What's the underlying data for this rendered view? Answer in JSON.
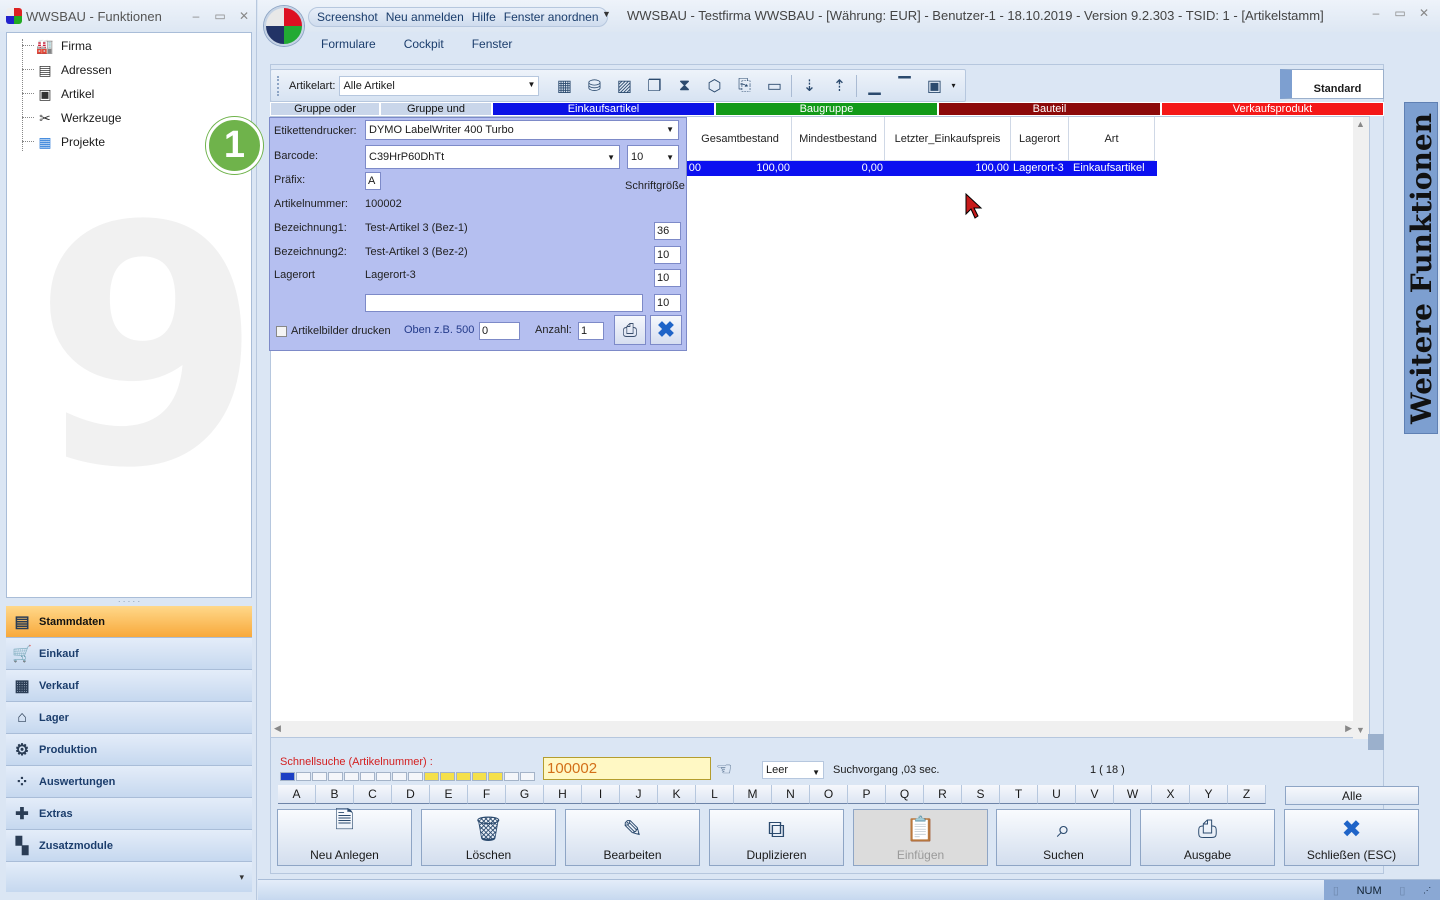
{
  "left_window": {
    "title": "WWSBAU - Funktionen",
    "controls": {
      "minimize": "–",
      "maximize": "▭",
      "close": "✕"
    },
    "watermark": "9",
    "tree": [
      {
        "label": "Firma",
        "icon": "factory-icon"
      },
      {
        "label": "Adressen",
        "icon": "address-card-icon"
      },
      {
        "label": "Artikel",
        "icon": "box-icon"
      },
      {
        "label": "Werkzeuge",
        "icon": "tools-icon"
      },
      {
        "label": "Projekte",
        "icon": "project-icon"
      }
    ],
    "nav": [
      {
        "label": "Stammdaten",
        "icon": "master-data-icon",
        "active": true
      },
      {
        "label": "Einkauf",
        "icon": "cart-icon"
      },
      {
        "label": "Verkauf",
        "icon": "cash-register-icon"
      },
      {
        "label": "Lager",
        "icon": "warehouse-icon"
      },
      {
        "label": "Produktion",
        "icon": "production-icon"
      },
      {
        "label": "Auswertungen",
        "icon": "analytics-icon"
      },
      {
        "label": "Extras",
        "icon": "extras-icon"
      },
      {
        "label": "Zusatzmodule",
        "icon": "modules-icon"
      }
    ]
  },
  "main_window": {
    "quick_access": [
      "Screenshot",
      "Neu anmelden",
      "Hilfe",
      "Fenster anordnen"
    ],
    "title": "WWSBAU - Testfirma WWSBAU - [Währung: EUR] - Benutzer-1 - 18.10.2019 - Version 9.2.303 - TSID: 1  - [Artikelstamm]",
    "menu": [
      "Formulare",
      "Cockpit",
      "Fenster"
    ],
    "controls": {
      "minimize": "–",
      "maximize": "▭",
      "close": "✕"
    }
  },
  "toolbar": {
    "artikelart_label": "Artikelart:",
    "artikelart_value": "Alle Artikel",
    "standard_label": "Standard"
  },
  "group_strip": [
    {
      "label": "Gruppe oder",
      "bg": "#c9d6ea",
      "fg": "#111111"
    },
    {
      "label": "Gruppe und",
      "bg": "#c9d6ea",
      "fg": "#111111"
    },
    {
      "label": "Einkaufsartikel",
      "bg": "#0b12e6",
      "fg": "#ffffff"
    },
    {
      "label": "Baugruppe",
      "bg": "#129a18",
      "fg": "#ffffff"
    },
    {
      "label": "Bauteil",
      "bg": "#8c0a0a",
      "fg": "#ffffff"
    },
    {
      "label": "Verkaufsprodukt",
      "bg": "#f41818",
      "fg": "#ffffff"
    }
  ],
  "grid": {
    "headers": [
      "Gesamtbestand",
      "Mindestbestand",
      "Letzter_Einkaufspreis",
      "Lagerort",
      "Art"
    ],
    "row": {
      "prev_cell": "00",
      "gesamtbestand": "100,00",
      "mindestbestand": "0,00",
      "letzter_einkaufspreis": "100,00",
      "lagerort": "Lagerort-3",
      "art": "Einkaufsartikel"
    }
  },
  "label_dialog": {
    "etikettendrucker_label": "Etikettendrucker:",
    "etikettendrucker_value": "DYMO LabelWriter 400 Turbo",
    "barcode_label": "Barcode:",
    "barcode_value": "C39HrP60DhTt",
    "barcode_size": "10",
    "praefix_label": "Präfix:",
    "praefix_value": "A",
    "schriftgroesse_label": "Schriftgröße",
    "artikelnummer_label": "Artikelnummer:",
    "artikelnummer_value": "100002",
    "bez1_label": "Bezeichnung1:",
    "bez1_value": "Test-Artikel 3  (Bez-1)",
    "bez1_size": "36",
    "bez2_label": "Bezeichnung2:",
    "bez2_value": "Test-Artikel 3  (Bez-2)",
    "bez2_size": "10",
    "lagerort_label": "Lagerort",
    "lagerort_value": "Lagerort-3",
    "lagerort_size": "10",
    "extra_value": "",
    "extra_size": "10",
    "artikelbilder_label": "Artikelbilder drucken",
    "oben_label": "Oben z.B. 500",
    "oben_value": "0",
    "anzahl_label": "Anzahl:",
    "anzahl_value": "1"
  },
  "step_badge": "1",
  "side_panel": {
    "label": "Weitere Funktionen"
  },
  "search": {
    "label": "Schnellsuche (Artikelnummer) :",
    "value": "100002",
    "mode": "Leer",
    "time": "Suchvorgang ,03 sec.",
    "result": "1  ( 18 )"
  },
  "alphabet": [
    "A",
    "B",
    "C",
    "D",
    "E",
    "F",
    "G",
    "H",
    "I",
    "J",
    "K",
    "L",
    "M",
    "N",
    "O",
    "P",
    "Q",
    "R",
    "S",
    "T",
    "U",
    "V",
    "W",
    "X",
    "Y",
    "Z"
  ],
  "alle_label": "Alle",
  "actions": [
    {
      "label": "Neu Anlegen",
      "icon": "new-document-icon",
      "glyph": "🗎"
    },
    {
      "label": "Löschen",
      "icon": "trash-icon",
      "glyph": "🗑"
    },
    {
      "label": "Bearbeiten",
      "icon": "edit-icon",
      "glyph": "✎"
    },
    {
      "label": "Duplizieren",
      "icon": "duplicate-icon",
      "glyph": "⧉"
    },
    {
      "label": "Einfügen",
      "icon": "paste-icon",
      "glyph": "📋",
      "disabled": true
    },
    {
      "label": "Suchen",
      "icon": "binoculars-icon",
      "glyph": "⌕"
    },
    {
      "label": "Ausgabe",
      "icon": "printer-icon",
      "glyph": "⎙"
    },
    {
      "label": "Schließen (ESC)",
      "icon": "close-icon",
      "glyph": "✖"
    }
  ],
  "status_bar": {
    "num": "NUM"
  }
}
